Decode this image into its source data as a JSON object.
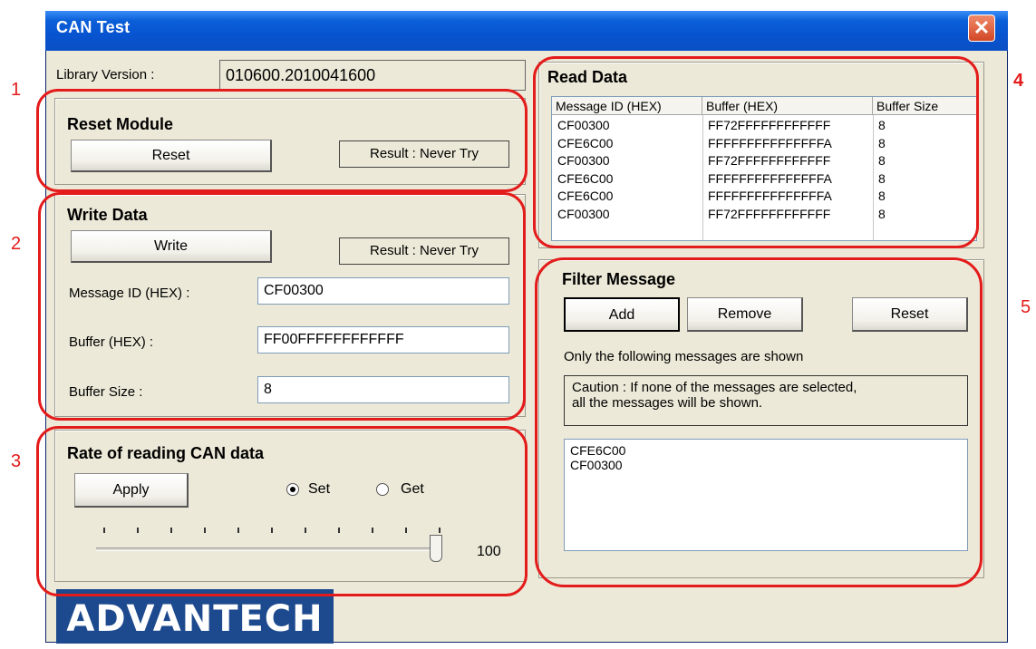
{
  "window": {
    "title": "CAN Test",
    "close_glyph": "✕"
  },
  "library": {
    "label": "Library Version :",
    "value": "010600.2010041600"
  },
  "reset_module": {
    "title": "Reset Module",
    "button": "Reset",
    "result": "Result : Never Try"
  },
  "write_data": {
    "title": "Write Data",
    "button": "Write",
    "result": "Result : Never Try",
    "message_id_label": "Message ID (HEX) :",
    "message_id_value": "CF00300",
    "buffer_label": "Buffer (HEX) :",
    "buffer_value": "FF00FFFFFFFFFFFF",
    "buffer_size_label": "Buffer Size :",
    "buffer_size_value": "8"
  },
  "rate": {
    "title": "Rate of reading CAN data",
    "button": "Apply",
    "radio_set": "Set",
    "radio_get": "Get",
    "selected": "Set",
    "slider_value": "100",
    "slider_level": 1.0
  },
  "read_data": {
    "title": "Read Data",
    "columns": [
      "Message ID (HEX)",
      "Buffer (HEX)",
      "Buffer Size"
    ],
    "rows": [
      [
        "CF00300",
        "FF72FFFFFFFFFFFF",
        "8"
      ],
      [
        "CFE6C00",
        "FFFFFFFFFFFFFFFA",
        "8"
      ],
      [
        "CF00300",
        "FF72FFFFFFFFFFFF",
        "8"
      ],
      [
        "CFE6C00",
        "FFFFFFFFFFFFFFFA",
        "8"
      ],
      [
        "CFE6C00",
        "FFFFFFFFFFFFFFFA",
        "8"
      ],
      [
        "CF00300",
        "FF72FFFFFFFFFFFF",
        "8"
      ]
    ]
  },
  "filter": {
    "title": "Filter Message",
    "add": "Add",
    "remove": "Remove",
    "reset": "Reset",
    "info": "Only the following messages are shown",
    "caution_line1": "Caution : If none of the messages are selected,",
    "caution_line2": "all the messages will be shown.",
    "items": [
      "CFE6C00",
      "CF00300"
    ]
  },
  "markers": [
    "1",
    "2",
    "3",
    "4",
    "5"
  ],
  "logo": {
    "text": "ADVANTECH"
  },
  "colors": {
    "highlight": "#e41b1b",
    "titlebar": "#0a5fd8",
    "dialog": "#ece9d8"
  }
}
